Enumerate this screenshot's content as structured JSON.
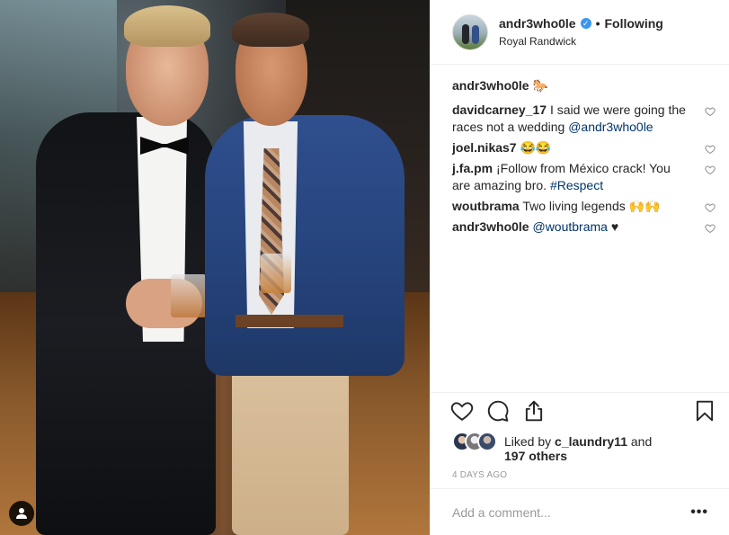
{
  "post": {
    "username": "andr3who0le",
    "follow_status": "Following",
    "dot": "•",
    "location": "Royal Randwick",
    "verified": true
  },
  "caption": {
    "username": "andr3who0le",
    "text": "🐎"
  },
  "comments": [
    {
      "username": "davidcarney_17",
      "text": "I said we were going the races not a wedding ",
      "mention": "@andr3who0le"
    },
    {
      "username": "joel.nikas7",
      "text": "😂😂",
      "mention": ""
    },
    {
      "username": "j.fa.pm",
      "text": "¡Follow from México crack! You are amazing bro. ",
      "mention": "#Respect"
    },
    {
      "username": "woutbrama",
      "text": "Two living legends 🙌🙌",
      "mention": ""
    },
    {
      "username": "andr3who0le",
      "text": "",
      "mention": "@woutbrama",
      "suffix": " ♥"
    }
  ],
  "actions": {
    "like_icon": "heart-outline-icon",
    "comment_icon": "speech-bubble-icon",
    "share_icon": "share-icon",
    "save_icon": "bookmark-icon"
  },
  "likes": {
    "prefix": "Liked by ",
    "user": "c_laundry11",
    "connector": " and",
    "others": "197 others"
  },
  "timestamp": "4 DAYS AGO",
  "add_comment": {
    "placeholder": "Add a comment..."
  },
  "more_options": "•••",
  "colors": {
    "link": "#003569",
    "verified": "#3897f0",
    "muted": "#999999",
    "text": "#262626"
  }
}
